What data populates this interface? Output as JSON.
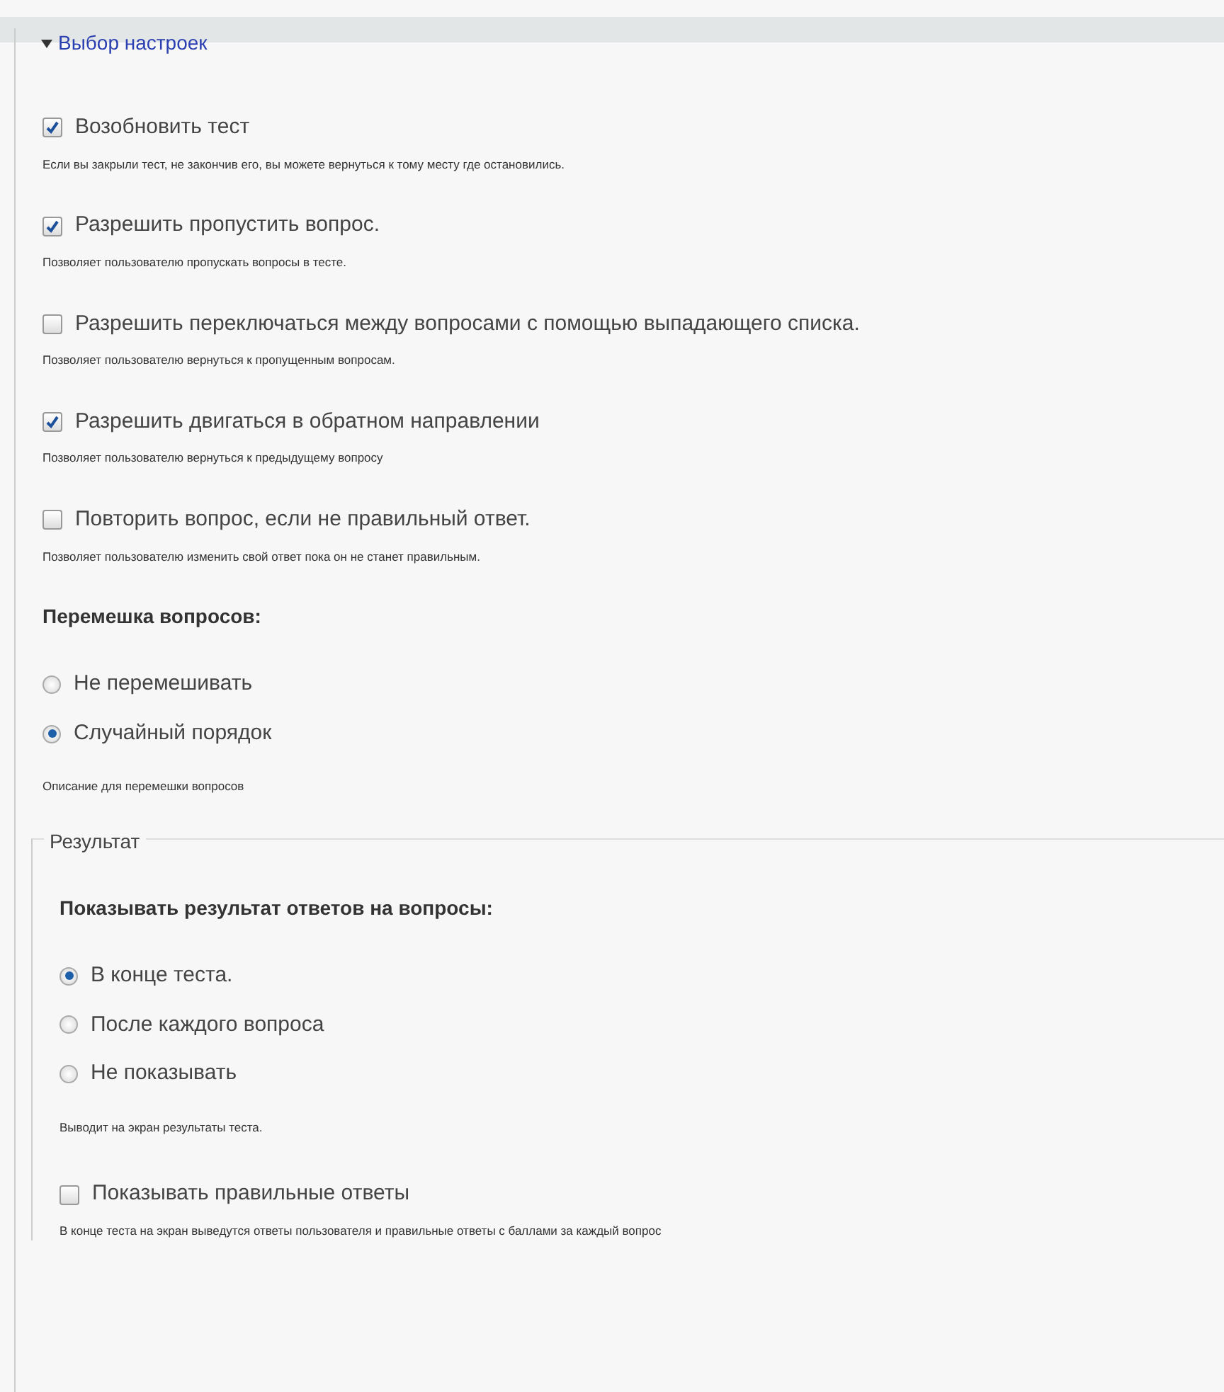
{
  "section": {
    "title": "Выбор настроек",
    "expanded": true
  },
  "items": [
    {
      "kind": "checkbox",
      "label": "Возобновить тест",
      "checked": true,
      "description": "Если вы закрыли тест, не закончив его, вы можете вернуться к тому месту где остановились."
    },
    {
      "kind": "checkbox",
      "label": "Разрешить пропустить вопрос.",
      "checked": true,
      "description": "Позволяет пользователю пропускать вопросы в тесте."
    },
    {
      "kind": "checkbox",
      "label": "Разрешить переключаться между вопросами с помощью выпадающего списка.",
      "checked": false,
      "description": "Позволяет пользователю вернуться к пропущенным вопросам."
    },
    {
      "kind": "checkbox",
      "label": "Разрешить двигаться в обратном направлении",
      "checked": true,
      "description": "Позволяет пользователю вернуться к предыдущему вопросу"
    },
    {
      "kind": "checkbox",
      "label": "Повторить вопрос, если не правильный ответ.",
      "checked": false,
      "description": "Позволяет пользователю изменить свой ответ пока он не станет правильным."
    },
    {
      "kind": "radio_group",
      "title": "Перемешка вопросов:",
      "options": [
        {
          "label": "Не перемешивать",
          "selected": false
        },
        {
          "label": "Случайный порядок",
          "selected": true
        }
      ],
      "description": "Описание для перемешки вопросов"
    },
    {
      "kind": "fieldset",
      "legend": "Результат",
      "items": [
        {
          "kind": "radio_group",
          "title": "Показывать результат ответов на вопросы:",
          "options": [
            {
              "label": "В конце теста.",
              "selected": true
            },
            {
              "label": "После каждого вопроса",
              "selected": false
            },
            {
              "label": "Не показывать",
              "selected": false
            }
          ],
          "description": "Выводит на экран результаты теста."
        },
        {
          "kind": "checkbox",
          "label": "Показывать правильные ответы",
          "checked": false,
          "description": "В конце теста на экран выведутся ответы пользователя и правильные ответы с баллами за каждый вопрос"
        }
      ]
    }
  ]
}
